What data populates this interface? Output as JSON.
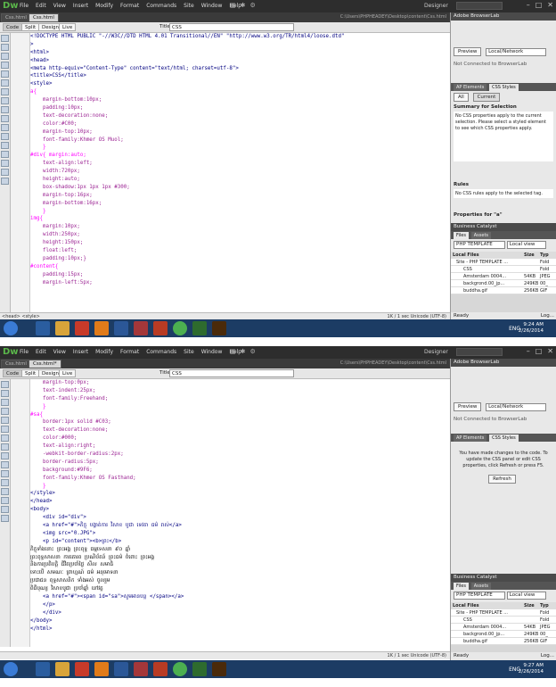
{
  "app": {
    "logo": "Dw",
    "menu": [
      "File",
      "Edit",
      "View",
      "Insert",
      "Modify",
      "Format",
      "Commands",
      "Site",
      "Window",
      "Help"
    ],
    "workspace": "Designer",
    "path": "C:\\Users\\PHPHEADEY\\Desktop\\content\\Css.html"
  },
  "view": {
    "buttons": [
      "Code",
      "Split",
      "Design",
      "Live"
    ],
    "title_label": "Title:",
    "title_value": "CSS"
  },
  "shot1": {
    "tabs": [
      "Css.html",
      "Css.html"
    ],
    "lines": [
      {
        "n": "1",
        "t": "<!DOCTYPE HTML PUBLIC \"-//W3C//DTD HTML 4.01 Transitional//EN\" \"http://www.w3.org/TR/html4/loose.dtd\"",
        "c": "t-tag"
      },
      {
        "n": "2",
        "t": ">",
        "c": "t-tag"
      },
      {
        "n": "3",
        "t": "<html>",
        "c": "t-tag"
      },
      {
        "n": "4",
        "t": "<head>",
        "c": "t-tag"
      },
      {
        "n": "5",
        "t": "<meta http-equiv=\"Content-Type\" content=\"text/html; charset=utf-8\">",
        "c": "t-tag"
      },
      {
        "n": "6",
        "t": "<title>CSS</title>",
        "c": "t-tag"
      },
      {
        "n": "7",
        "t": "<style>",
        "c": "t-tag"
      },
      {
        "n": "8",
        "t": "a{",
        "c": "t-sel"
      },
      {
        "n": "9",
        "t": "    margin-bottom:10px;",
        "c": "t-css"
      },
      {
        "n": "10",
        "t": "    padding:10px;",
        "c": "t-css"
      },
      {
        "n": "11",
        "t": "    text-decoration:none;",
        "c": "t-css"
      },
      {
        "n": "12",
        "t": "    color:#C00;",
        "c": "t-css"
      },
      {
        "n": "13",
        "t": "    margin-top:10px;",
        "c": "t-css"
      },
      {
        "n": "14",
        "t": "    font-family:Khmer OS Muol;",
        "c": "t-css"
      },
      {
        "n": "15",
        "t": "    }",
        "c": "t-sel"
      },
      {
        "n": "16",
        "t": "#div{ margin:auto;",
        "c": "t-sel"
      },
      {
        "n": "17",
        "t": "    text-align:left;",
        "c": "t-css"
      },
      {
        "n": "18",
        "t": "    width:720px;",
        "c": "t-css"
      },
      {
        "n": "19",
        "t": "    height:auto;",
        "c": "t-css"
      },
      {
        "n": "20",
        "t": "    box-shadow:1px 1px 1px #300;",
        "c": "t-css"
      },
      {
        "n": "21",
        "t": "    margin-top:16px;",
        "c": "t-css"
      },
      {
        "n": "22",
        "t": "    margin-bottom:16px;",
        "c": "t-css"
      },
      {
        "n": "23",
        "t": "    }",
        "c": "t-sel"
      },
      {
        "n": "24",
        "t": "img{",
        "c": "t-sel"
      },
      {
        "n": "25",
        "t": "    margin:10px;",
        "c": "t-css"
      },
      {
        "n": "26",
        "t": "    width:250px;",
        "c": "t-css"
      },
      {
        "n": "27",
        "t": "    height:150px;",
        "c": "t-css"
      },
      {
        "n": "28",
        "t": "    float:left;",
        "c": "t-css"
      },
      {
        "n": "29",
        "t": "    padding:10px;}",
        "c": "t-css"
      },
      {
        "n": "30",
        "t": "#content{",
        "c": "t-sel"
      },
      {
        "n": "31",
        "t": "    padding:15px;",
        "c": "t-css"
      },
      {
        "n": "32",
        "t": "    margin-left:5px;",
        "c": "t-css"
      }
    ],
    "status_left": "<head> <style>",
    "status_right": "1K / 1 sec  Unicode (UTF-8)",
    "clock_time": "9:24 AM",
    "clock_date": "2/26/2014"
  },
  "shot2": {
    "tabs": [
      "Css.html",
      "Css.html*"
    ],
    "lines": [
      {
        "n": "32",
        "t": "    margin-top:0px;",
        "c": "t-css"
      },
      {
        "n": "33",
        "t": "    text-indent:25px;",
        "c": "t-css"
      },
      {
        "n": "34",
        "t": "    font-family:Freehand;",
        "c": "t-css"
      },
      {
        "n": "35",
        "t": "    }",
        "c": "t-sel"
      },
      {
        "n": "36",
        "t": "#sa{",
        "c": "t-sel"
      },
      {
        "n": "37",
        "t": "    border:1px solid #C03;",
        "c": "t-css"
      },
      {
        "n": "38",
        "t": "    text-decoration:none;",
        "c": "t-css"
      },
      {
        "n": "39",
        "t": "    color:#000;",
        "c": "t-css"
      },
      {
        "n": "40",
        "t": "    text-align:right;",
        "c": "t-css"
      },
      {
        "n": "41",
        "t": "    -webkit-border-radius:2px;",
        "c": "t-css"
      },
      {
        "n": "42",
        "t": "    border-radius:5px;",
        "c": "t-css"
      },
      {
        "n": "43",
        "t": "    background:#9F6;",
        "c": "t-css"
      },
      {
        "n": "44",
        "t": "    font-family:Khmer OS Fasthand;",
        "c": "t-css"
      },
      {
        "n": "45",
        "t": "    }",
        "c": "t-sel"
      },
      {
        "n": "46",
        "t": "</style>",
        "c": "t-tag"
      },
      {
        "n": "47",
        "t": "</head>",
        "c": "t-tag"
      },
      {
        "n": "48",
        "t": "<body>",
        "c": "t-tag"
      },
      {
        "n": "49",
        "t": "    <div id=\"div\">",
        "c": "t-tag"
      },
      {
        "n": "50",
        "t": "    <a href=\"#\">ភិក្ខុ បង្ហាត់ការ វិសាខ បូជា ទេវតា ធម៌ រាស់</a>",
        "c": "t-tag"
      },
      {
        "n": "51",
        "t": "    <img src=\"0.JPG\">",
        "c": "t-tag"
      },
      {
        "n": "52",
        "t": "    <p id=\"content\"><b>ព្រះ</b>",
        "c": "t-tag"
      },
      {
        "n": "53",
        "t": "ភិក្ខុទាំងនោះ ព្រះអង្គ ព្រះពុទ្ធ ធម្មទេសនា ៩០ ឆ្នាំ",
        "c": "t-kh"
      },
      {
        "n": "54",
        "t": "ព្រះពុទ្ធសាសនា ការគោរព ប្រណិប័តន៍ ព្រះធម៌ ចំពោះ ព្រះអង្គ",
        "c": "t-kh"
      },
      {
        "n": "55",
        "t": "និងការប្រតិបត្តិ ជីវិតប្រចាំថ្ងៃ សីល សមាធិ",
        "c": "t-kh"
      },
      {
        "n": "56",
        "t": "ទោះបើ សមណៈ ព្រាហ្មណ៍ ធម៌ អនុមោទនា",
        "c": "t-kh"
      },
      {
        "n": "57",
        "t": "ប្រជាជន ពុទ្ធសាសនិក ទាំងអស់ ចូលរួម",
        "c": "t-kh"
      },
      {
        "n": "58",
        "t": "ពិធីបុណ្យ វិសាខបូជា ប្រចាំឆ្នាំ នៅវត្ត",
        "c": "t-kh"
      },
      {
        "n": "59",
        "t": "    <a href=\"#\"><span id=\"sa\">សូមអានបន្ត </span></a>",
        "c": "t-tag"
      },
      {
        "n": "60",
        "t": "    </p>",
        "c": "t-tag"
      },
      {
        "n": "61",
        "t": "    </div>",
        "c": "t-tag"
      },
      {
        "n": "62",
        "t": "</body>",
        "c": "t-tag"
      },
      {
        "n": "63",
        "t": "</html>",
        "c": "t-tag"
      }
    ],
    "status_left": "",
    "status_right": "1K / 1 sec  Unicode (UTF-8)",
    "clock_time": "9:27 AM",
    "clock_date": "2/26/2014"
  },
  "panel": {
    "browserlab": "Adobe BrowserLab",
    "preview": "Preview",
    "local_network": "Local/Network",
    "not_connected": "Not Connected to BrowserLab",
    "ap_tab": "AP Elements",
    "css_tab": "CSS Styles",
    "all": "All",
    "current": "Current",
    "summary_title": "Summary for Selection",
    "summary_text": "No CSS properties apply to the current selection. Please select a styled element to see which CSS properties apply.",
    "rules": "Rules",
    "rules_text": "No CSS rules apply to the selected tag.",
    "props": "Properties for \"a\"",
    "refresh_text": "You have made changes to the code. To update the CSS panel or edit CSS properties, click Refresh or press F5.",
    "refresh": "Refresh",
    "bc": "Business Catalyst",
    "files": "Files",
    "assets": "Assets",
    "site": "PHP TEMPLATE",
    "local_view": "Local view",
    "local_files": "Local Files",
    "size": "Size",
    "type": "Typ",
    "file_rows": [
      {
        "name": "Site - PHP TEMPLATE ...",
        "size": "",
        "type": "Fold"
      },
      {
        "name": "CSS",
        "size": "",
        "type": "Fold"
      },
      {
        "name": "Amsterdam 0004...",
        "size": "54KB",
        "type": "JPEG"
      },
      {
        "name": "backgrond.00_jp...",
        "size": "249KB",
        "type": "00_"
      },
      {
        "name": "buddha.gif",
        "size": "256KB",
        "type": "GIF"
      }
    ],
    "ready": "Ready",
    "log": "Log...",
    "eng": "ENG"
  }
}
